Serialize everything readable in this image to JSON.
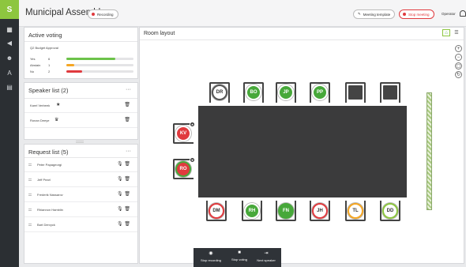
{
  "app": {
    "logo": "S"
  },
  "rail": {
    "items": [
      {
        "icon": "dashboard-icon",
        "glyph": "▦"
      },
      {
        "icon": "speaker-icon",
        "glyph": "◀"
      },
      {
        "icon": "users-icon",
        "glyph": "☻"
      },
      {
        "icon": "translate-icon",
        "glyph": "A"
      },
      {
        "icon": "document-icon",
        "glyph": "▤"
      }
    ]
  },
  "header": {
    "title": "Municipal Assembly",
    "recording_label": "Recording",
    "meeting_template_label": "Meeting template",
    "stop_meeting_label": "Stop meeting",
    "operator_label": "Operator"
  },
  "voting": {
    "title": "Active voting",
    "item": "Q2 Budget Approval",
    "rows": [
      {
        "label": "Yes",
        "count": "6",
        "fraction": 0.73,
        "color": "#6cc24a"
      },
      {
        "label": "Abstain",
        "count": "1",
        "fraction": 0.12,
        "color": "#f5a623"
      },
      {
        "label": "No",
        "count": "2",
        "fraction": 0.24,
        "color": "#e03a3e"
      }
    ]
  },
  "speakers": {
    "title": "Speaker list",
    "count": "(2)",
    "items": [
      {
        "name": "Karel Verbeek",
        "icon": "star-icon",
        "glyph": "★"
      },
      {
        "name": "Ronan Deeye",
        "icon": "crown-icon",
        "glyph": "♛"
      }
    ]
  },
  "requests": {
    "title": "Request list",
    "count": "(5)",
    "items": [
      {
        "name": "Peter Papageorgi"
      },
      {
        "name": "Jeff Pearl"
      },
      {
        "name": "Frederik Nassarov"
      },
      {
        "name": "Rhiannon Hamblin"
      },
      {
        "name": "Bart Dervyck"
      }
    ]
  },
  "room": {
    "title": "Room layout",
    "top_seats": [
      {
        "initials": "DR",
        "fill": "#ffffff",
        "ring": "#555555",
        "text": "#333333"
      },
      {
        "initials": "BO",
        "fill": "#47a83a",
        "ring": "#ffffff",
        "text": "#ffffff"
      },
      {
        "initials": "JP",
        "fill": "#47a83a",
        "ring": "#ffffff",
        "text": "#ffffff"
      },
      {
        "initials": "PP",
        "fill": "#47a83a",
        "ring": "#ffffff",
        "text": "#ffffff"
      },
      {
        "initials": "",
        "fill": "",
        "ring": "",
        "text": ""
      },
      {
        "initials": "",
        "fill": "",
        "ring": "",
        "text": ""
      }
    ],
    "bottom_seats": [
      {
        "initials": "DM",
        "fill": "#ffffff",
        "ring": "#e03a3e",
        "text": "#333333"
      },
      {
        "initials": "RH",
        "fill": "#47a83a",
        "ring": "#ffffff",
        "text": "#ffffff"
      },
      {
        "initials": "FN",
        "fill": "#47a83a",
        "ring": "#47a83a",
        "text": "#ffffff"
      },
      {
        "initials": "JH",
        "fill": "#ffffff",
        "ring": "#e03a3e",
        "text": "#333333"
      },
      {
        "initials": "TL",
        "fill": "#ffffff",
        "ring": "#f5a623",
        "text": "#333333"
      },
      {
        "initials": "DD",
        "fill": "#ffffff",
        "ring": "#8dc63f",
        "text": "#333333"
      }
    ],
    "left_seats": [
      {
        "initials": "KV",
        "fill": "#e03a3e",
        "ring": "#ffffff",
        "text": "#ffffff",
        "badge": "★"
      },
      {
        "initials": "RO",
        "fill": "#e03a3e",
        "ring": "#47a83a",
        "text": "#ffffff",
        "badge": "♛"
      }
    ],
    "zoom_controls": [
      {
        "icon": "zoom-in-icon",
        "glyph": "+"
      },
      {
        "icon": "zoom-out-icon",
        "glyph": "−"
      },
      {
        "icon": "fit-icon",
        "glyph": "▢"
      },
      {
        "icon": "reset-icon",
        "glyph": "↻"
      }
    ]
  },
  "bottombar": {
    "items": [
      {
        "label": "Stop recording",
        "icon": "record-icon",
        "glyph": "◉"
      },
      {
        "label": "Stop voting",
        "icon": "stop-icon",
        "glyph": "■"
      },
      {
        "label": "Next speaker",
        "icon": "next-speaker-icon",
        "glyph": "⇥"
      }
    ]
  }
}
